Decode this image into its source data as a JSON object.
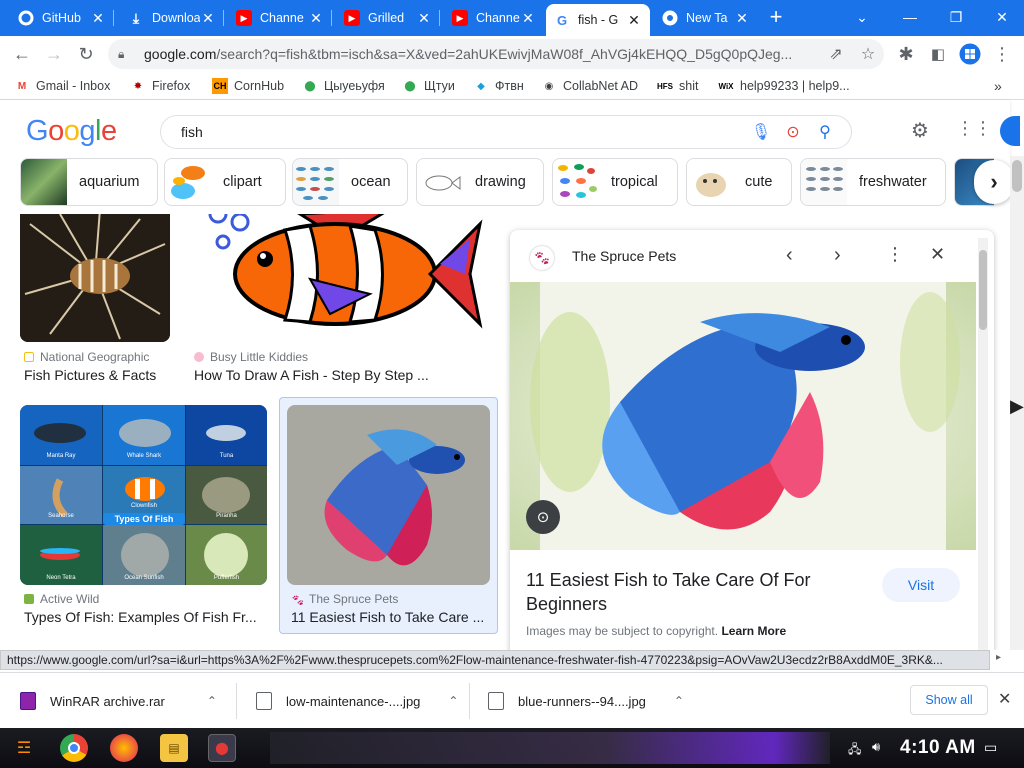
{
  "tabs": [
    {
      "title": "GitHub",
      "icon": "github-icon"
    },
    {
      "title": "Downloa",
      "icon": "download-icon"
    },
    {
      "title": "Channe",
      "icon": "youtube-icon"
    },
    {
      "title": "Grilled",
      "icon": "youtube-icon"
    },
    {
      "title": "Channe",
      "icon": "youtube-icon"
    },
    {
      "title": "fish - G",
      "icon": "google-icon",
      "active": true
    },
    {
      "title": "New Ta",
      "icon": "chrome-icon"
    }
  ],
  "address_bar": {
    "url_host": "google.com",
    "url_rest": "/search?q=fish&tbm=isch&sa=X&ved=2ahUKEwivjMaW08f_AhVGj4kEHQQ_D5gQ0pQJeg..."
  },
  "bookmarks": [
    {
      "label": "Gmail - Inbox",
      "icon": "gmail-icon"
    },
    {
      "label": "Firefox",
      "icon": "firefox-icon"
    },
    {
      "label": "CornHub",
      "icon": "ch-icon"
    },
    {
      "label": "Цыуеьуфя",
      "icon": "location-pin-icon"
    },
    {
      "label": "Щтуи",
      "icon": "location-pin-icon"
    },
    {
      "label": "Фтвн",
      "icon": "diamond-icon"
    },
    {
      "label": "CollabNet AD",
      "icon": "collabnet-icon"
    },
    {
      "label": "shit",
      "icon": "hfs-icon"
    },
    {
      "label": "help99233 | help9...",
      "icon": "wix-icon"
    }
  ],
  "google": {
    "logo": "Google",
    "query": "fish",
    "chips": [
      "aquarium",
      "clipart",
      "ocean",
      "drawing",
      "tropical",
      "cute",
      "freshwater"
    ]
  },
  "results": [
    {
      "source": "National Geographic",
      "caption": "Fish Pictures & Facts"
    },
    {
      "source": "Busy Little Kiddies",
      "caption": "How To Draw A Fish - Step By Step ..."
    },
    {
      "source": "Active Wild",
      "caption": "Types Of Fish: Examples Of Fish Fr..."
    },
    {
      "source": "The Spruce Pets",
      "caption": "11 Easiest Fish to Take Care ..."
    }
  ],
  "types_labels": [
    "Manta Ray",
    "Whale Shark",
    "Tuna",
    "Seahorse",
    "Clownfish",
    "Piranha",
    "Neon Tetra",
    "Ocean Sunfish",
    "Pufferfish"
  ],
  "types_banner": "Types Of Fish",
  "panel": {
    "source": "The Spruce Pets",
    "title_line1": "11 Easiest Fish to Take Care Of For",
    "title_line2": "Beginners",
    "visit": "Visit",
    "copyright": "Images may be subject to copyright.",
    "learn_more": "Learn More"
  },
  "status_url": "https://www.google.com/url?sa=i&url=https%3A%2F%2Fwww.thesprucepets.com%2Flow-maintenance-freshwater-fish-4770223&psig=AOvVaw2U3ecdz2rB8AxddM0E_3RK&...",
  "downloads": [
    {
      "name": "WinRAR archive.rar"
    },
    {
      "name": "low-maintenance-....jpg"
    },
    {
      "name": "blue-runners--94....jpg"
    }
  ],
  "show_all": "Show all",
  "clock": "4:10 AM",
  "colors": {
    "tabstrip": "#1a73e8",
    "accent": "#1a73e8"
  }
}
